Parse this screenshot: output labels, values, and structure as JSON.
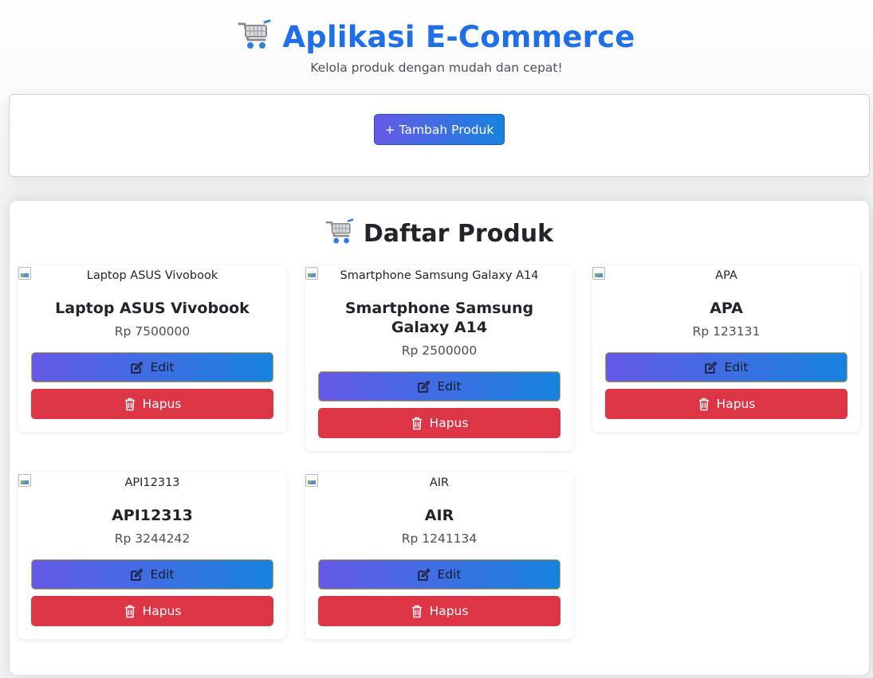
{
  "header": {
    "title": "Aplikasi E-Commerce",
    "subtitle": "Kelola produk dengan mudah dan cepat!",
    "icon": "shopping-cart-icon"
  },
  "actions": {
    "add_label": "+ Tambah Produk"
  },
  "product_list": {
    "title": "Daftar Produk",
    "icon": "shopping-cart-icon",
    "edit_label": "Edit",
    "delete_label": "Hapus",
    "products": [
      {
        "image_alt": "Laptop ASUS Vivobook",
        "name": "Laptop ASUS Vivobook",
        "price": "Rp 7500000"
      },
      {
        "image_alt": "Smartphone Samsung Galaxy A14",
        "name": "Smartphone Samsung Galaxy A14",
        "price": "Rp 2500000"
      },
      {
        "image_alt": "APA",
        "name": "APA",
        "price": "Rp 123131"
      },
      {
        "image_alt": "API12313",
        "name": "API12313",
        "price": "Rp 3244242"
      },
      {
        "image_alt": "AIR",
        "name": "AIR",
        "price": "Rp 1241134"
      }
    ]
  },
  "colors": {
    "title_blue": "#1e6fe8",
    "gradient_start": "#6559e6",
    "gradient_end": "#1783df",
    "delete_red": "#dc3545"
  }
}
